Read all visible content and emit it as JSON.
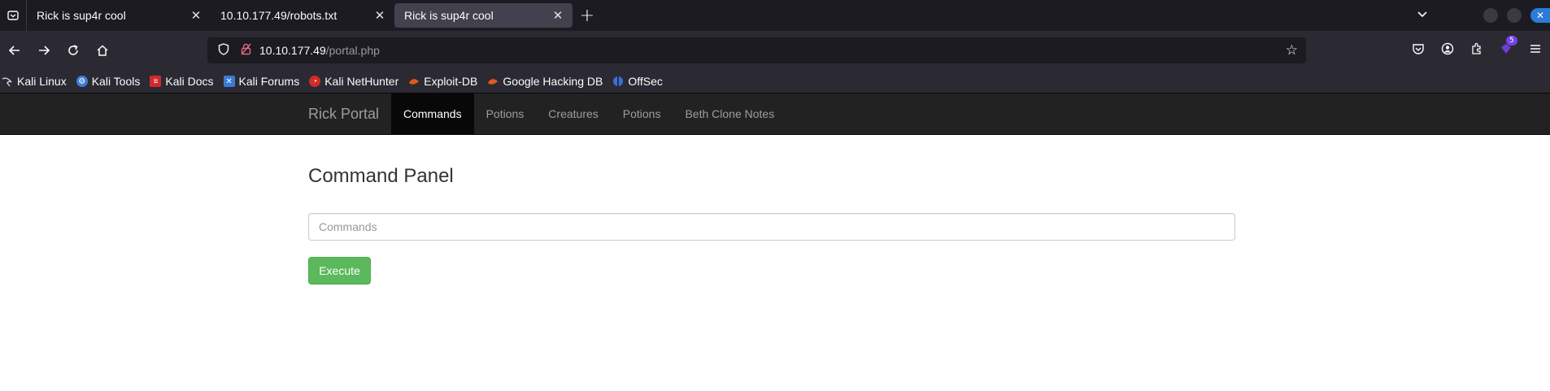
{
  "browser": {
    "tabs": [
      {
        "title": "Rick is sup4r cool",
        "active": false
      },
      {
        "title": "10.10.177.49/robots.txt",
        "active": false
      },
      {
        "title": "Rick is sup4r cool",
        "active": true
      }
    ],
    "url": {
      "host": "10.10.177.49",
      "path": "/portal.php"
    },
    "extension_badge": "5",
    "bookmarks": [
      {
        "label": "Kali Linux",
        "icon": "kali-dragon-icon",
        "color": "#1c1b22"
      },
      {
        "label": "Kali Tools",
        "icon": "kali-tools-icon",
        "color": "#3d7dd6"
      },
      {
        "label": "Kali Docs",
        "icon": "kali-docs-icon",
        "color": "#d12a2a"
      },
      {
        "label": "Kali Forums",
        "icon": "kali-forums-icon",
        "color": "#3a7bd5"
      },
      {
        "label": "Kali NetHunter",
        "icon": "nethunter-icon",
        "color": "#d12a2a"
      },
      {
        "label": "Exploit-DB",
        "icon": "exploit-db-icon",
        "color": "#e05a1c"
      },
      {
        "label": "Google Hacking DB",
        "icon": "ghdb-icon",
        "color": "#e05a1c"
      },
      {
        "label": "OffSec",
        "icon": "offsec-icon",
        "color": "#3d6fd6"
      }
    ]
  },
  "site": {
    "brand": "Rick Portal",
    "nav": [
      "Commands",
      "Potions",
      "Creatures",
      "Potions",
      "Beth Clone Notes"
    ],
    "active_nav": "Commands",
    "heading": "Command Panel",
    "input_placeholder": "Commands",
    "button_label": "Execute",
    "colors": {
      "navbar": "#222222",
      "button": "#5cb85c"
    }
  }
}
